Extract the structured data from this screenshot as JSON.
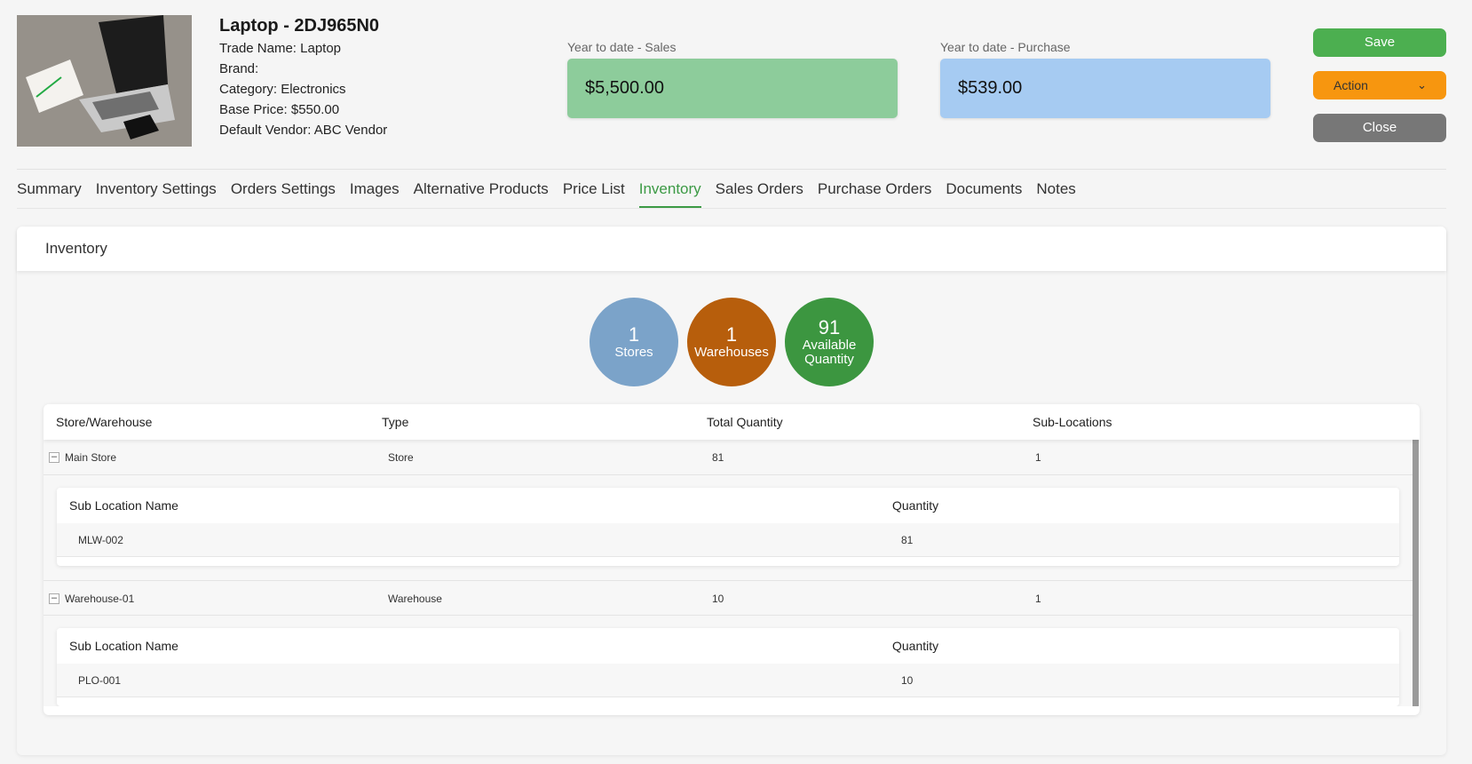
{
  "product": {
    "title": "Laptop - 2DJ965N0",
    "trade_name": "Trade Name: Laptop",
    "brand": "Brand:",
    "category": "Category: Electronics",
    "base_price": "Base Price: $550.00",
    "default_vendor": "Default Vendor: ABC Vendor"
  },
  "kpis": {
    "sales": {
      "label": "Year to date - Sales",
      "value": "$5,500.00",
      "color": "#8dcc9b"
    },
    "purchase": {
      "label": "Year to date - Purchase",
      "value": "$539.00",
      "color": "#a6cbf2"
    }
  },
  "buttons": {
    "save": "Save",
    "action": "Action",
    "close": "Close"
  },
  "tabs": [
    {
      "label": "Summary"
    },
    {
      "label": "Inventory Settings"
    },
    {
      "label": "Orders Settings"
    },
    {
      "label": "Images"
    },
    {
      "label": "Alternative Products"
    },
    {
      "label": "Price List"
    },
    {
      "label": "Inventory",
      "active": true
    },
    {
      "label": "Sales Orders"
    },
    {
      "label": "Purchase Orders"
    },
    {
      "label": "Documents"
    },
    {
      "label": "Notes"
    }
  ],
  "inventory": {
    "panel_title": "Inventory",
    "stats": [
      {
        "value": "1",
        "label": "Stores",
        "color": "#7ba3c9"
      },
      {
        "value": "1",
        "label": "Warehouses",
        "color": "#b75e0c"
      },
      {
        "value": "91",
        "label": "Available Quantity",
        "color": "#3c9640"
      }
    ],
    "columns": [
      "Store/Warehouse",
      "Type",
      "Total Quantity",
      "Sub-Locations"
    ],
    "sub_columns": [
      "Sub Location Name",
      "Quantity"
    ],
    "rows": [
      {
        "name": "Main Store",
        "type": "Store",
        "total": "81",
        "sublocations": "1",
        "toggle": "–",
        "sub": [
          {
            "name": "MLW-002",
            "qty": "81"
          }
        ]
      },
      {
        "name": "Warehouse-01",
        "type": "Warehouse",
        "total": "10",
        "sublocations": "1",
        "toggle": "–",
        "sub": [
          {
            "name": "PLO-001",
            "qty": "10"
          }
        ]
      }
    ]
  }
}
